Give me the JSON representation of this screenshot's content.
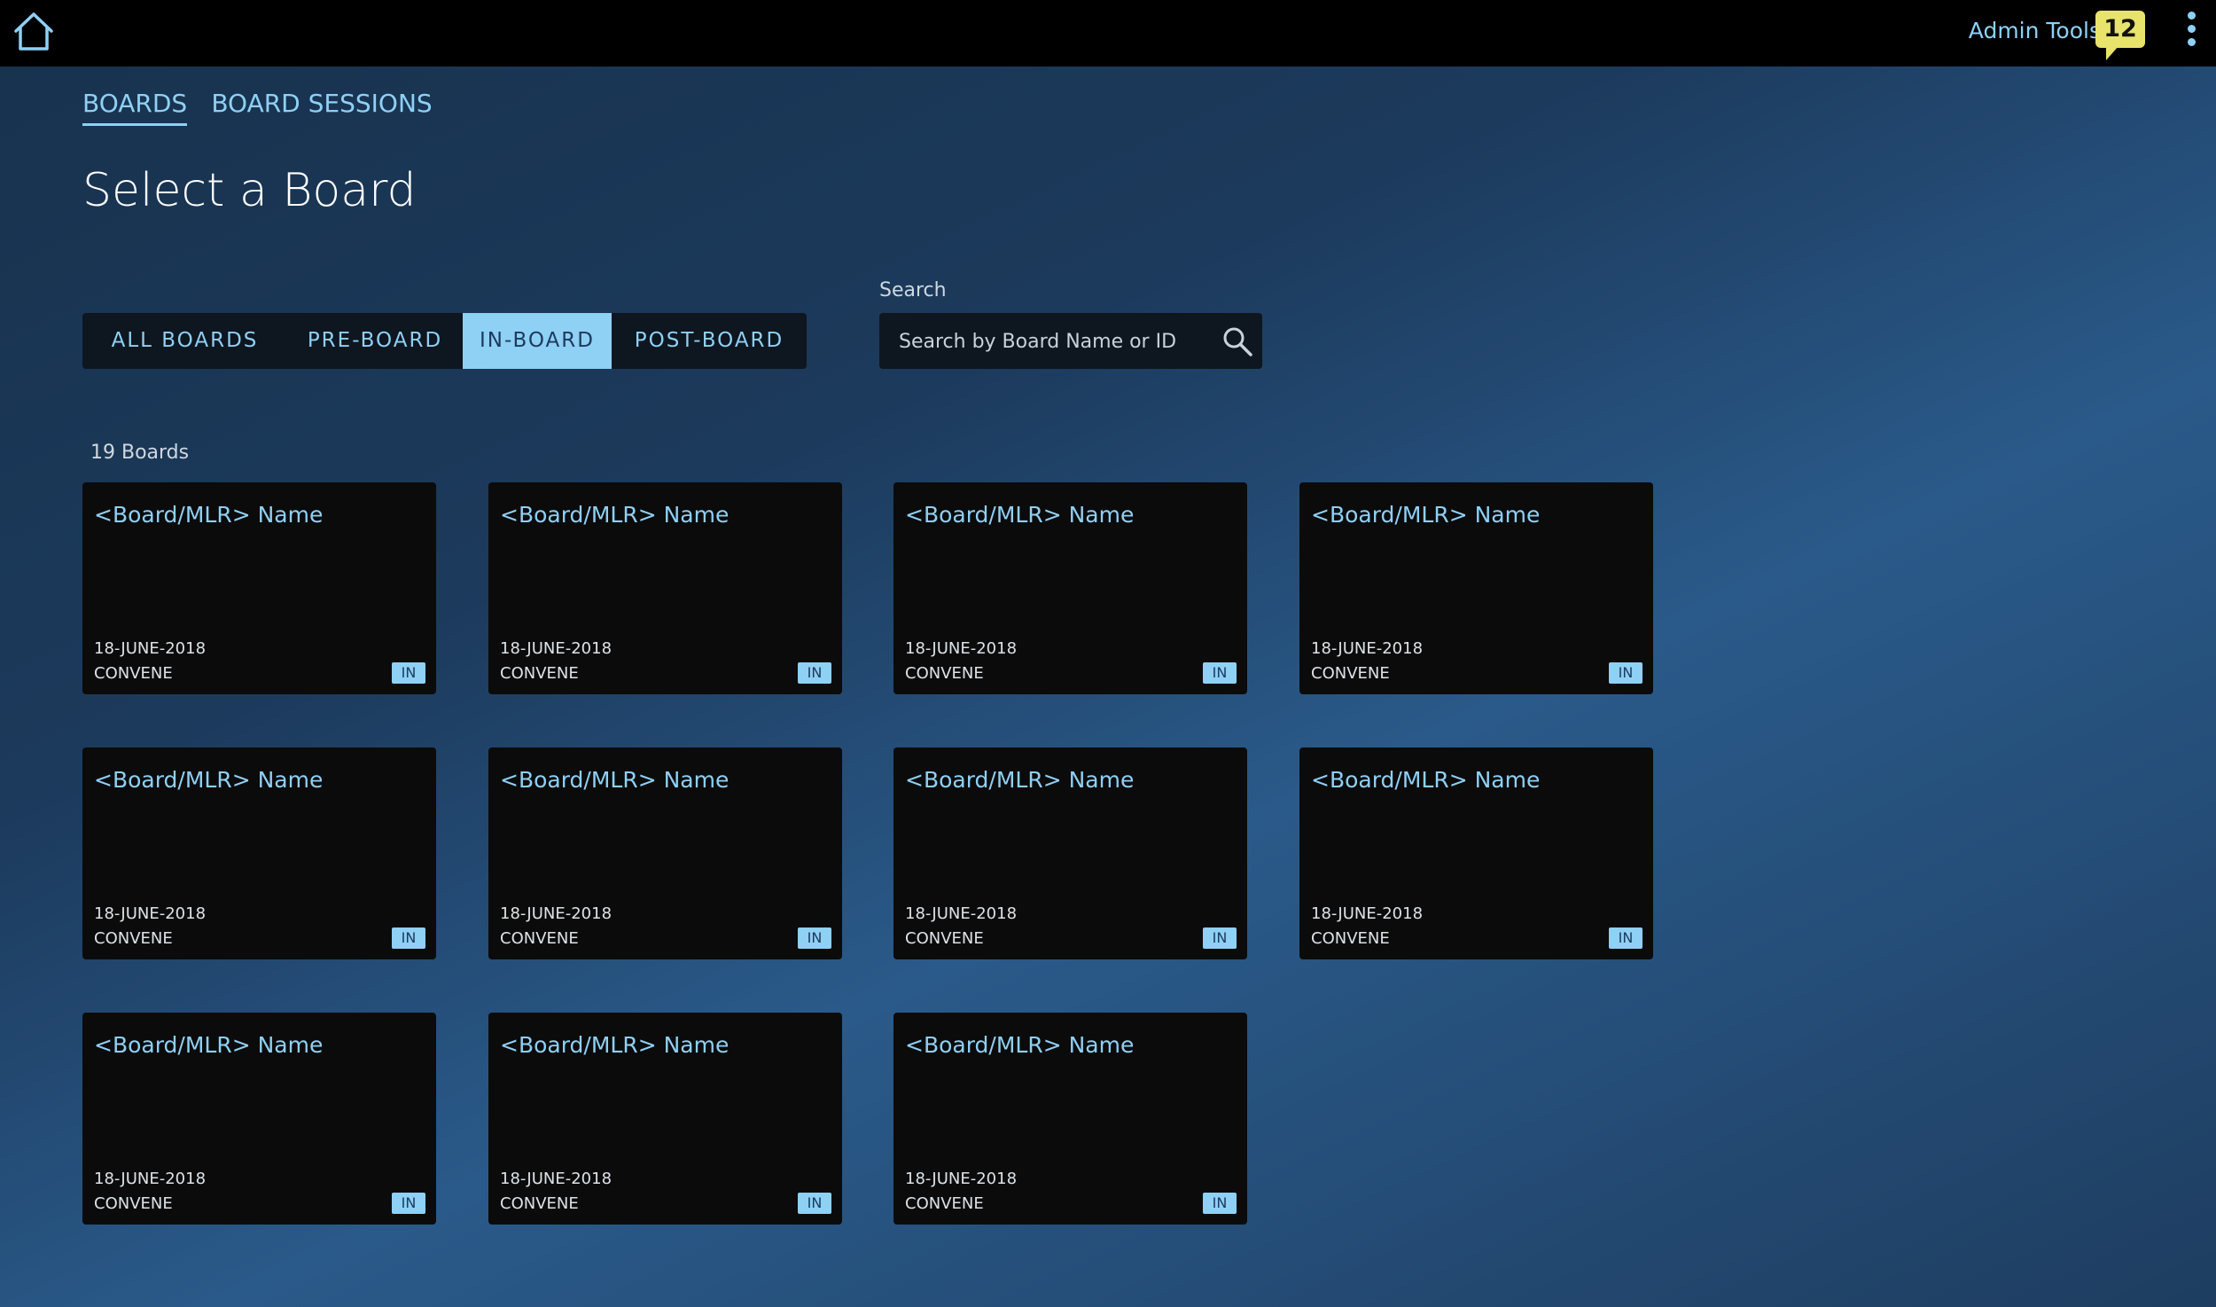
{
  "topbar": {
    "admin_tools": "Admin Tools",
    "notification_count": "12"
  },
  "tabs": [
    {
      "label": "BOARDS",
      "active": true
    },
    {
      "label": "BOARD SESSIONS",
      "active": false
    }
  ],
  "page_title": "Select a Board",
  "filters": [
    {
      "label": "ALL BOARDS",
      "active": false
    },
    {
      "label": "PRE-BOARD",
      "active": false
    },
    {
      "label": "IN-BOARD",
      "active": true
    },
    {
      "label": "POST-BOARD",
      "active": false
    }
  ],
  "search": {
    "label": "Search",
    "placeholder": "Search by Board Name or ID"
  },
  "count_label": "19 Boards",
  "cards": [
    {
      "name": "<Board/MLR> Name",
      "date": "18-JUNE-2018",
      "org": "CONVENE",
      "badge": "IN"
    },
    {
      "name": "<Board/MLR> Name",
      "date": "18-JUNE-2018",
      "org": "CONVENE",
      "badge": "IN"
    },
    {
      "name": "<Board/MLR> Name",
      "date": "18-JUNE-2018",
      "org": "CONVENE",
      "badge": "IN"
    },
    {
      "name": "<Board/MLR> Name",
      "date": "18-JUNE-2018",
      "org": "CONVENE",
      "badge": "IN"
    },
    {
      "name": "<Board/MLR> Name",
      "date": "18-JUNE-2018",
      "org": "CONVENE",
      "badge": "IN"
    },
    {
      "name": "<Board/MLR> Name",
      "date": "18-JUNE-2018",
      "org": "CONVENE",
      "badge": "IN"
    },
    {
      "name": "<Board/MLR> Name",
      "date": "18-JUNE-2018",
      "org": "CONVENE",
      "badge": "IN"
    },
    {
      "name": "<Board/MLR> Name",
      "date": "18-JUNE-2018",
      "org": "CONVENE",
      "badge": "IN"
    },
    {
      "name": "<Board/MLR> Name",
      "date": "18-JUNE-2018",
      "org": "CONVENE",
      "badge": "IN"
    },
    {
      "name": "<Board/MLR> Name",
      "date": "18-JUNE-2018",
      "org": "CONVENE",
      "badge": "IN"
    },
    {
      "name": "<Board/MLR> Name",
      "date": "18-JUNE-2018",
      "org": "CONVENE",
      "badge": "IN"
    }
  ]
}
